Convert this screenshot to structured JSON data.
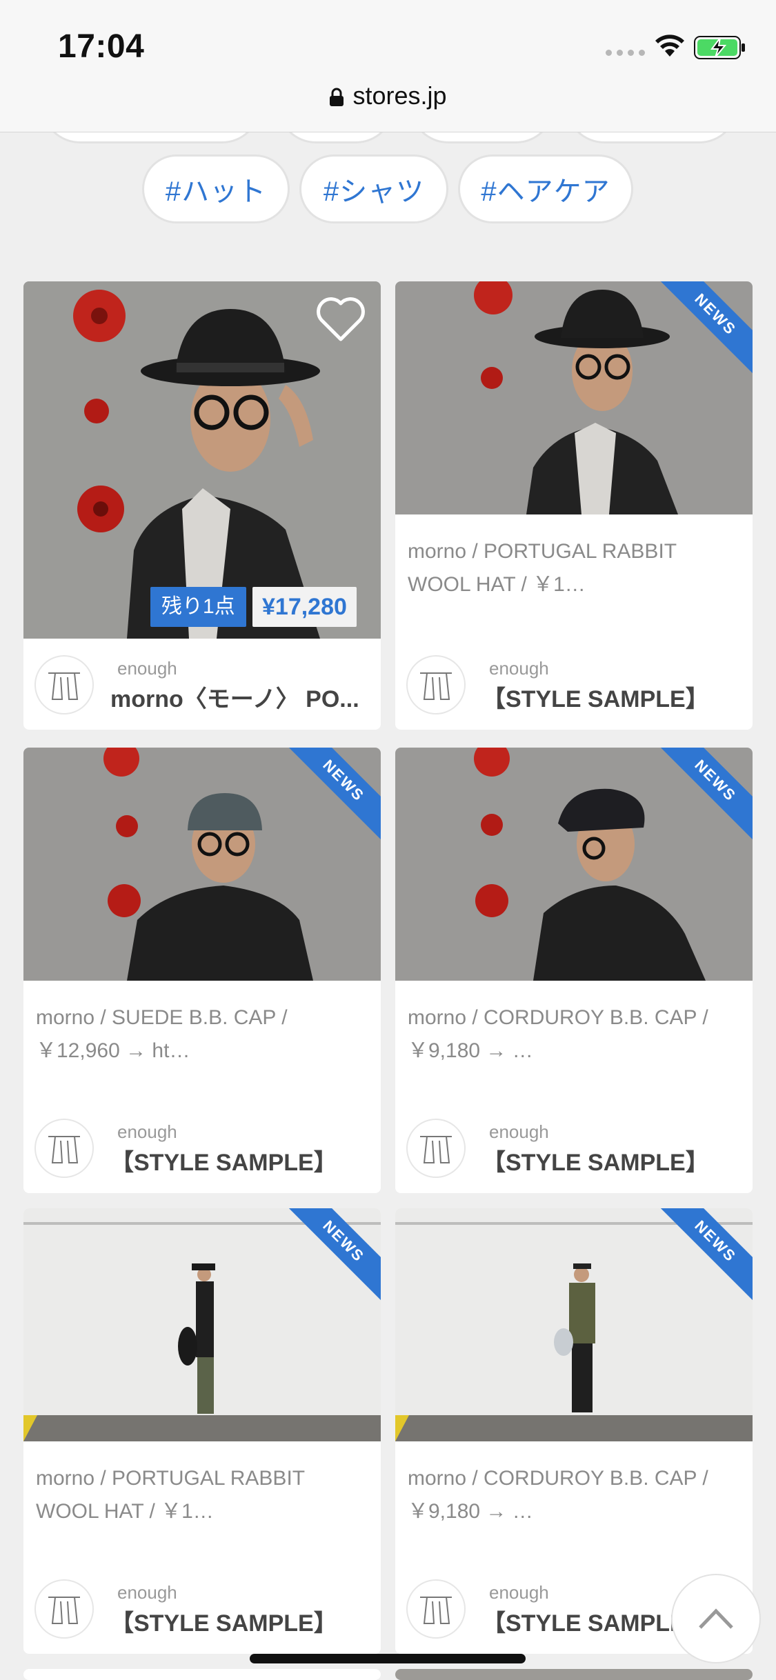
{
  "status_bar": {
    "time": "17:04"
  },
  "browser": {
    "url": "stores.jp"
  },
  "tags": [
    "#ハット",
    "#シャツ",
    "#ヘアケア"
  ],
  "cards": [
    {
      "title": "morno〈モーノ〉 PO...",
      "shop": "enough",
      "stock_badge": "残り1点",
      "price": "¥17,280",
      "liked": false
    },
    {
      "description": "morno / PORTUGAL RABBIT WOOL HAT / ￥1…",
      "shop": "enough",
      "title": "【STYLE SAMPLE】",
      "ribbon": "NEWS"
    },
    {
      "description": "morno / SUEDE B.B. CAP / ￥12,960 → ht…",
      "shop": "enough",
      "title": "【STYLE SAMPLE】",
      "ribbon": "NEWS"
    },
    {
      "description": "morno / CORDUROY B.B. CAP / ￥9,180 → …",
      "shop": "enough",
      "title": "【STYLE SAMPLE】",
      "ribbon": "NEWS"
    },
    {
      "description": "morno / PORTUGAL RABBIT WOOL HAT / ￥1…",
      "shop": "enough",
      "title": "【STYLE SAMPLE】",
      "ribbon": "NEWS"
    },
    {
      "description": "morno / CORDUROY B.B. CAP / ￥9,180 → …",
      "shop": "enough",
      "title": "【STYLE SAMPLE】",
      "ribbon": "NEWS"
    }
  ],
  "colors": {
    "accent": "#2f76d2",
    "background": "#efefef"
  }
}
